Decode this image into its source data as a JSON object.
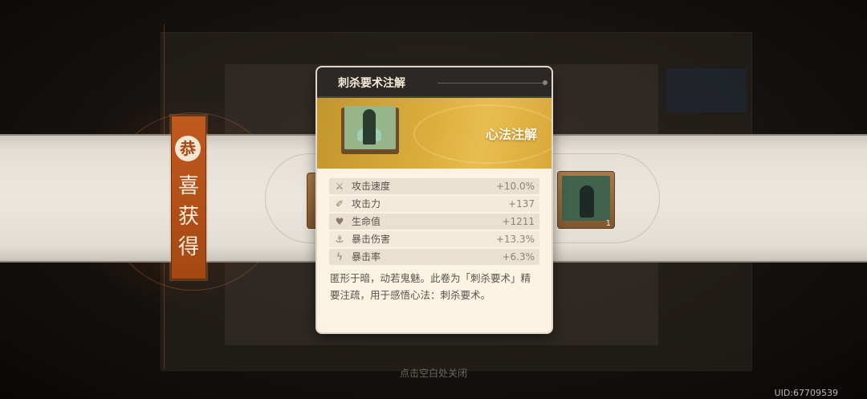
{
  "card": {
    "title": "刺杀要术注解",
    "type_label": "心法注解",
    "stats": [
      {
        "icon": "attack-speed-icon",
        "glyph": "⚔",
        "name": "攻击速度",
        "value": "+10.0%"
      },
      {
        "icon": "attack-icon",
        "glyph": "✐",
        "name": "攻击力",
        "value": "+137"
      },
      {
        "icon": "heart-icon",
        "glyph": "♥",
        "name": "生命值",
        "value": "+1211"
      },
      {
        "icon": "crit-damage-icon",
        "glyph": "⚓",
        "name": "暴击伤害",
        "value": "+13.3%"
      },
      {
        "icon": "crit-rate-icon",
        "glyph": "ϟ",
        "name": "暴击率",
        "value": "+6.3%"
      }
    ],
    "description": "匿形于暗，动若鬼魅。此卷为「刺杀要术」精要注疏，用于感悟心法：刺杀要术。"
  },
  "banner": {
    "circle_char": "恭",
    "chars": [
      "喜",
      "获",
      "得"
    ]
  },
  "reward_item": {
    "count": "1"
  },
  "close_hint": "点击空白处关闭",
  "uid": "UID:67709539"
}
